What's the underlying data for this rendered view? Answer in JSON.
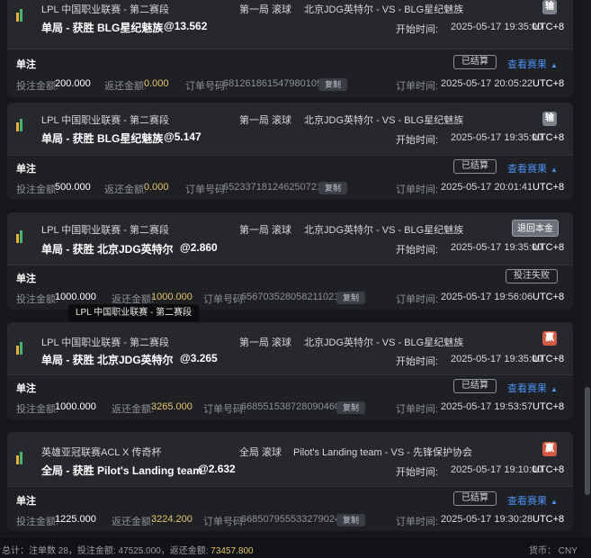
{
  "labels": {
    "start_time": "开始时间:",
    "single_bet": "单注",
    "stake": "投注金额:",
    "return": "返还金额:",
    "order_no": "订单号码:",
    "copy": "复制",
    "settled": "已结算",
    "view_result": "查看赛果",
    "order_time": "订单时间:"
  },
  "bets": [
    {
      "league": "LPL 中国职业联赛 - 第二赛段",
      "market": "第一局 滚球",
      "teams": "北京JDG英特尔 - VS - BLG星纪魅族",
      "selection": "单局 - 获胜 BLG星纪魅族",
      "odds": "@13.562",
      "start_time": "2025-05-17 19:35:00",
      "timezone": "UTC+8",
      "badge": "输",
      "status": "已结算",
      "stake": "200.000",
      "return_amount": "0.000",
      "order_no": "681261861547980109",
      "order_time": "2025-05-17 20:05:22"
    },
    {
      "league": "LPL 中国职业联赛 - 第二赛段",
      "market": "第一局 滚球",
      "teams": "北京JDG英特尔 - VS - BLG星纪魅族",
      "selection": "单局 - 获胜 BLG星纪魅族",
      "odds": "@5.147",
      "start_time": "2025-05-17 19:35:00",
      "timezone": "UTC+8",
      "badge": "输",
      "status": "已结算",
      "stake": "500.000",
      "return_amount": "0.000",
      "order_no": "652337181246250721",
      "order_time": "2025-05-17 20:01:41"
    },
    {
      "league": "LPL 中国职业联赛 - 第二赛段",
      "market": "第一局 滚球",
      "teams": "北京JDG英特尔 - VS - BLG星纪魅族",
      "selection": "单局 - 获胜 北京JDG英特尔",
      "odds": "@2.860",
      "start_time": "2025-05-17 19:35:00",
      "timezone": "UTC+8",
      "badge": "退回本金",
      "status": "投注失败",
      "stake": "1000.000",
      "return_amount": "1000.000",
      "order_no": "656703528058211021",
      "order_time": "2025-05-17 19:56:06"
    },
    {
      "league": "LPL 中国职业联赛 - 第二赛段",
      "market": "第一局 滚球",
      "teams": "北京JDG英特尔 - VS - BLG星纪魅族",
      "selection": "单局 - 获胜 北京JDG英特尔",
      "odds": "@3.265",
      "start_time": "2025-05-17 19:35:00",
      "timezone": "UTC+8",
      "badge": "赢",
      "status": "已结算",
      "stake": "1000.000",
      "return_amount": "3265.000",
      "order_no": "668551538728090460",
      "order_time": "2025-05-17 19:53:57"
    },
    {
      "league": "英雄亚冠联赛ACL X 传奇杯",
      "market": "全局 滚球",
      "teams": "Pilot's Landing team - VS - 先锋保护协会",
      "selection": "全局 - 获胜 Pilot's Landing team",
      "odds": "@2.632",
      "start_time": "2025-05-17 19:10:00",
      "timezone": "UTC+8",
      "badge": "赢",
      "status": "已结算",
      "stake": "1225.000",
      "return_amount": "3224.200",
      "order_no": "668507955533279024",
      "order_time": "2025-05-17 19:30:28"
    }
  ],
  "tooltip": "LPL 中国职业联赛 - 第二赛段",
  "footer": {
    "summary_prefix": "总计：注单数 28，投注金额: 47525.000，返还金额: ",
    "total_return": "73457.800",
    "currency": "货币： CNY"
  },
  "colors": {
    "accent_link": "#4d8ff0",
    "amount_yellow": "#e5c56a",
    "badge_lose": "#7e828a",
    "badge_win": "#d25a45"
  }
}
